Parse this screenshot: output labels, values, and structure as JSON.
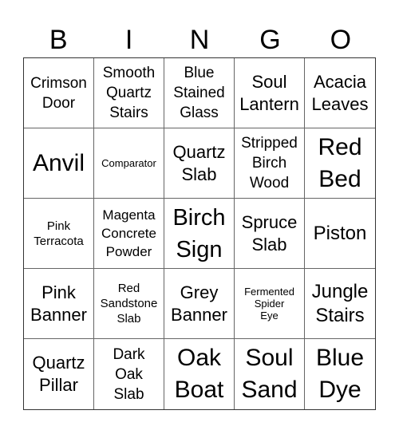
{
  "header": {
    "letters": [
      "B",
      "I",
      "N",
      "G",
      "O"
    ]
  },
  "cells": [
    {
      "text": "Crimson\nDoor",
      "size": "s4"
    },
    {
      "text": "Smooth\nQuartz\nStairs",
      "size": "s4"
    },
    {
      "text": "Blue\nStained\nGlass",
      "size": "s4"
    },
    {
      "text": "Soul\nLantern",
      "size": "s5"
    },
    {
      "text": "Acacia\nLeaves",
      "size": "s5"
    },
    {
      "text": "Anvil",
      "size": "s8"
    },
    {
      "text": "Comparator",
      "size": "s1"
    },
    {
      "text": "Quartz\nSlab",
      "size": "s5"
    },
    {
      "text": "Stripped\nBirch\nWood",
      "size": "s4"
    },
    {
      "text": "Red\nBed",
      "size": "s8"
    },
    {
      "text": "Pink\nTerracota",
      "size": "s2"
    },
    {
      "text": "Magenta\nConcrete\nPowder",
      "size": "s3"
    },
    {
      "text": "Birch\nSign",
      "size": "s7"
    },
    {
      "text": "Spruce\nSlab",
      "size": "s5"
    },
    {
      "text": "Piston",
      "size": "s6"
    },
    {
      "text": "Pink\nBanner",
      "size": "s5"
    },
    {
      "text": "Red\nSandstone\nSlab",
      "size": "s2"
    },
    {
      "text": "Grey\nBanner",
      "size": "s5"
    },
    {
      "text": "Fermented\nSpider\nEye",
      "size": "s1"
    },
    {
      "text": "Jungle\nStairs",
      "size": "s6"
    },
    {
      "text": "Quartz\nPillar",
      "size": "s5"
    },
    {
      "text": "Dark\nOak\nSlab",
      "size": "s4"
    },
    {
      "text": "Oak\nBoat",
      "size": "s8"
    },
    {
      "text": "Soul\nSand",
      "size": "s8"
    },
    {
      "text": "Blue\nDye",
      "size": "s8"
    }
  ]
}
